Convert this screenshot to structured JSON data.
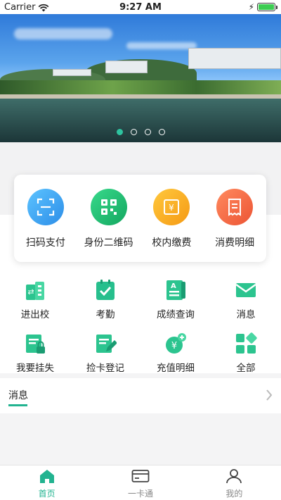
{
  "status_bar": {
    "carrier": "Carrier",
    "time": "9:27 AM",
    "battery_color": "#3ccd52"
  },
  "banner": {
    "slides": 4,
    "active_slide": 1
  },
  "quick_actions": [
    {
      "label": "扫码支付",
      "icon": "scan-pay-icon",
      "color": "#3aa6f2"
    },
    {
      "label": "身份二维码",
      "icon": "qr-code-icon",
      "color": "#1fbb73"
    },
    {
      "label": "校内缴费",
      "icon": "campus-payment-icon",
      "color": "#f5a623"
    },
    {
      "label": "消费明细",
      "icon": "consumption-detail-icon",
      "color": "#f0684a"
    }
  ],
  "services": [
    {
      "label": "进出校",
      "icon": "campus-access-icon"
    },
    {
      "label": "考勤",
      "icon": "attendance-icon"
    },
    {
      "label": "成绩查询",
      "icon": "grade-query-icon"
    },
    {
      "label": "消息",
      "icon": "message-icon"
    },
    {
      "label": "我要挂失",
      "icon": "report-loss-icon"
    },
    {
      "label": "捡卡登记",
      "icon": "found-card-icon"
    },
    {
      "label": "充值明细",
      "icon": "recharge-detail-icon"
    },
    {
      "label": "全部",
      "icon": "all-apps-icon"
    }
  ],
  "message_section": {
    "title": "消息"
  },
  "tabbar": [
    {
      "label": "首页",
      "icon": "home-icon",
      "active": true
    },
    {
      "label": "一卡通",
      "icon": "card-icon",
      "active": false
    },
    {
      "label": "我的",
      "icon": "profile-icon",
      "active": false
    }
  ],
  "accent_color": "#22b390"
}
